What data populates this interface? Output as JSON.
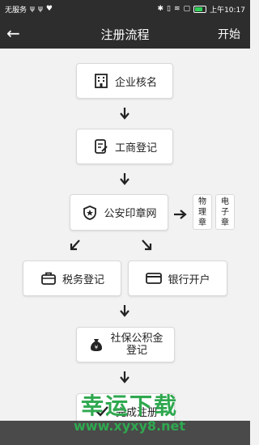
{
  "status": {
    "carrier": "无服务",
    "time": "上午10:17"
  },
  "nav": {
    "title": "注册流程",
    "action": "开始"
  },
  "steps": {
    "name_check": "企业核名",
    "business_reg": "工商登记",
    "police_seal": "公安印章网",
    "physical_seal": "物理章",
    "electronic_seal": "电子章",
    "tax_reg": "税务登记",
    "bank_account": "银行开户",
    "social_security_line1": "社保公积金",
    "social_security_line2": "登记",
    "complete": "完成注册"
  },
  "watermark": {
    "title": "幸运下载",
    "url": "www.xyxy8.net"
  },
  "colors": {
    "header": "#2d2d2d",
    "background": "#f2f2f2",
    "watermark": "#2fa84f"
  }
}
